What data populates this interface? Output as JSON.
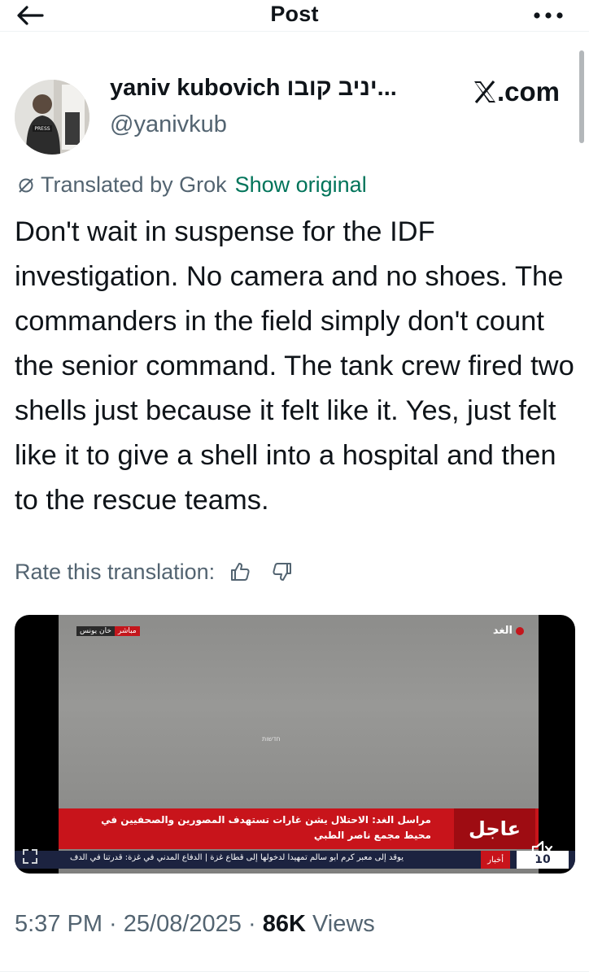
{
  "header": {
    "title": "Post"
  },
  "author": {
    "name": "yaniv kubovich יניב קובו...",
    "handle": "@yanivkub",
    "avatar_vest_text": "PRESS"
  },
  "source": {
    "label": ".com"
  },
  "translation": {
    "label": "Translated by Grok",
    "show_original": "Show original"
  },
  "post": {
    "text": "Don't wait in suspense for the IDF investigation. No camera and no shoes. The commanders in the field simply don't count the senior command. The tank crew fired two shells just because it felt like it. Yes, just felt like it to give a shell into a hospital and then to the rescue teams."
  },
  "rate": {
    "label": "Rate this translation:"
  },
  "media": {
    "tag_live": "مباشر",
    "tag_place": "خان يونس",
    "logo": "الغد",
    "watermark": "חדשות",
    "breaking_text": "مراسل الغد: الاحتلال يشن غارات تستهدف المصورين والصحفيين في محيط مجمع ناصر الطبي",
    "breaking_label": "عاجل",
    "ticker_text": "يوقد إلى معبر كرم أبو سالم تمهيدا لدخولها إلى قطاع غزة | الدفاع المدني في غزة: قدرتنا في الدف",
    "ticker_label": "أخبار",
    "clock": "10"
  },
  "meta": {
    "time": "5:37 PM",
    "separator": " · ",
    "date": "25/08/2025",
    "views_count": "86K",
    "views_label": " Views"
  },
  "colors": {
    "text_primary": "#0f1419",
    "text_secondary": "#536471",
    "show_original": "#00745a",
    "breaking_red": "#c8141b",
    "ticker_navy": "#1c2340"
  },
  "icons": {
    "back": "arrow-left-icon",
    "more": "more-horizontal-icon",
    "translate": "translate-slash-icon",
    "thumbs_up": "thumbs-up-icon",
    "thumbs_down": "thumbs-down-icon",
    "mute": "volume-muted-icon",
    "x_logo": "x-logo-icon",
    "expand": "expand-icon"
  }
}
